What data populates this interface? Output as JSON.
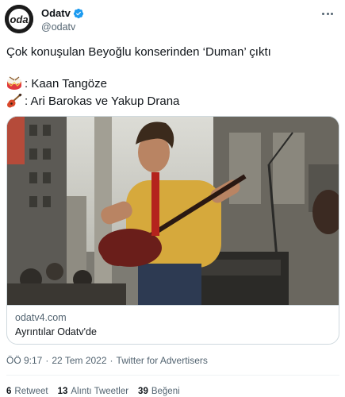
{
  "header": {
    "display_name": "Odatv",
    "handle": "@odatv",
    "verified": true,
    "avatar_icon": "odatv-logo-icon",
    "more_icon": "more-icon"
  },
  "tweet": {
    "text": "Çok konuşulan Beyoğlu konserinden ‘Duman’ çıktı",
    "line1": {
      "icon": "drum-icon",
      "text": ": Kaan Tangöze"
    },
    "line2": {
      "icon": "guitar-icon",
      "text": ": Ari Barokas ve Yakup Drana"
    }
  },
  "card": {
    "domain": "odatv4.com",
    "title": "Ayrıntılar Odatv'de"
  },
  "meta": {
    "time": "ÖÖ 9:17",
    "separator1": "·",
    "date": "22 Tem 2022",
    "separator2": "·",
    "source": "Twitter for Advertisers"
  },
  "stats": {
    "retweets_count": "6",
    "retweets_label": "Retweet",
    "quotes_count": "13",
    "quotes_label": "Alıntı Tweetler",
    "likes_count": "39",
    "likes_label": "Beğeni"
  },
  "colors": {
    "text_primary": "#0f1419",
    "text_secondary": "#536471",
    "border": "#cfd9de",
    "verified_blue": "#1d9bf0"
  }
}
